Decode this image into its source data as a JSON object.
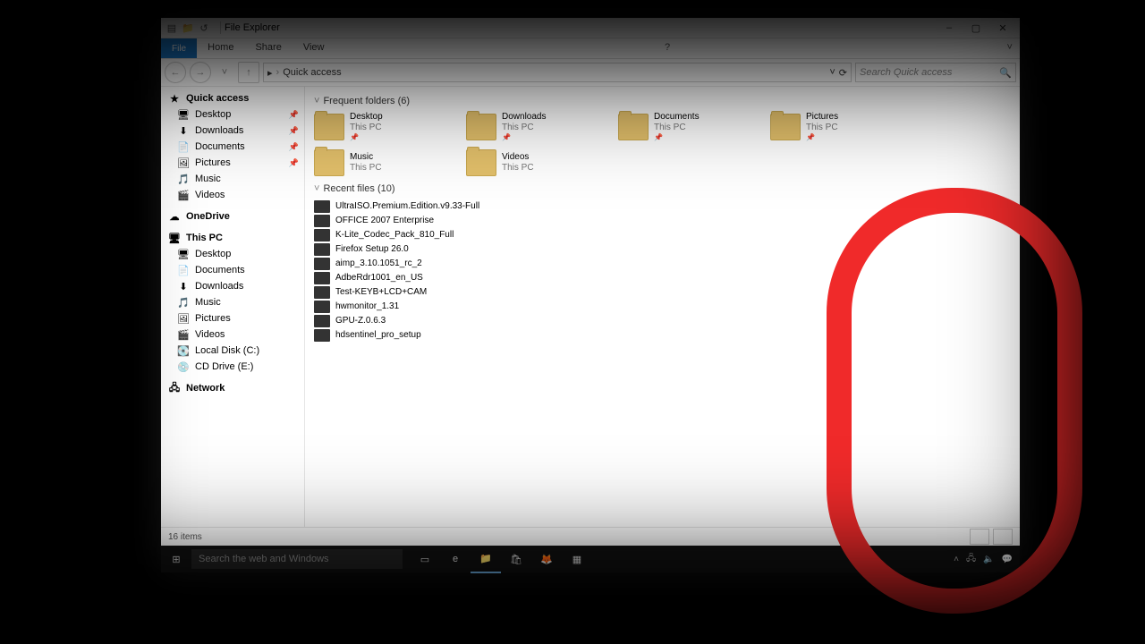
{
  "window": {
    "title": "File Explorer",
    "min": "–",
    "max": "▢",
    "close": "✕",
    "help": "?",
    "expand": "˅"
  },
  "ribbon": {
    "file": "File",
    "home": "Home",
    "share": "Share",
    "view": "View"
  },
  "address": {
    "back": "←",
    "fwd": "→",
    "up": "↑",
    "drop": "˅",
    "refresh": "⟳",
    "root": "▸",
    "loc": "Quick access",
    "search_placeholder": "Search Quick access",
    "mag": "🔍"
  },
  "nav": {
    "quick": {
      "label": "Quick access",
      "star": "★"
    },
    "quick_items": [
      {
        "label": "Desktop",
        "icon": "🖥",
        "pin": "📌"
      },
      {
        "label": "Downloads",
        "icon": "⬇",
        "pin": "📌"
      },
      {
        "label": "Documents",
        "icon": "📄",
        "pin": "📌"
      },
      {
        "label": "Pictures",
        "icon": "🖼",
        "pin": "📌"
      },
      {
        "label": "Music",
        "icon": "🎵",
        "pin": ""
      },
      {
        "label": "Videos",
        "icon": "🎬",
        "pin": ""
      }
    ],
    "onedrive": {
      "label": "OneDrive",
      "icon": "☁"
    },
    "thispc": {
      "label": "This PC",
      "icon": "🖥"
    },
    "pc_items": [
      {
        "label": "Desktop",
        "icon": "🖥"
      },
      {
        "label": "Documents",
        "icon": "📄"
      },
      {
        "label": "Downloads",
        "icon": "⬇"
      },
      {
        "label": "Music",
        "icon": "🎵"
      },
      {
        "label": "Pictures",
        "icon": "🖼"
      },
      {
        "label": "Videos",
        "icon": "🎬"
      },
      {
        "label": "Local Disk (C:)",
        "icon": "💽"
      },
      {
        "label": "CD Drive (E:)",
        "icon": "💿"
      }
    ],
    "network": {
      "label": "Network",
      "icon": "🖧"
    }
  },
  "content": {
    "group1": {
      "chev": "˅",
      "label": "Frequent folders (6)"
    },
    "folders": [
      {
        "name": "Desktop",
        "sub": "This PC"
      },
      {
        "name": "Downloads",
        "sub": "This PC"
      },
      {
        "name": "Documents",
        "sub": "This PC"
      },
      {
        "name": "Pictures",
        "sub": "This PC"
      },
      {
        "name": "Music",
        "sub": "This PC"
      },
      {
        "name": "Videos",
        "sub": "This PC"
      }
    ],
    "group2": {
      "chev": "˅",
      "label": "Recent files (10)"
    },
    "files": [
      {
        "name": "UltraISO.Premium.Edition.v9.33-Full"
      },
      {
        "name": "OFFICE 2007 Enterprise"
      },
      {
        "name": "K-Lite_Codec_Pack_810_Full"
      },
      {
        "name": "Firefox Setup 26.0"
      },
      {
        "name": "aimp_3.10.1051_rc_2"
      },
      {
        "name": "AdbeRdr1001_en_US"
      },
      {
        "name": "Test-KEYB+LCD+CAM"
      },
      {
        "name": "hwmonitor_1.31"
      },
      {
        "name": "GPU-Z.0.6.3"
      },
      {
        "name": "hdsentinel_pro_setup"
      }
    ]
  },
  "status": {
    "count": "16 items"
  },
  "taskbar": {
    "search": "Search the web and Windows",
    "start": "⊞",
    "taskview": "▭",
    "edge": "e",
    "explorer": "📁",
    "store": "🛍",
    "firefox": "🦊",
    "other": "▦",
    "tray_up": "˄",
    "net": "🖧",
    "vol": "🔈",
    "act": "💬"
  }
}
